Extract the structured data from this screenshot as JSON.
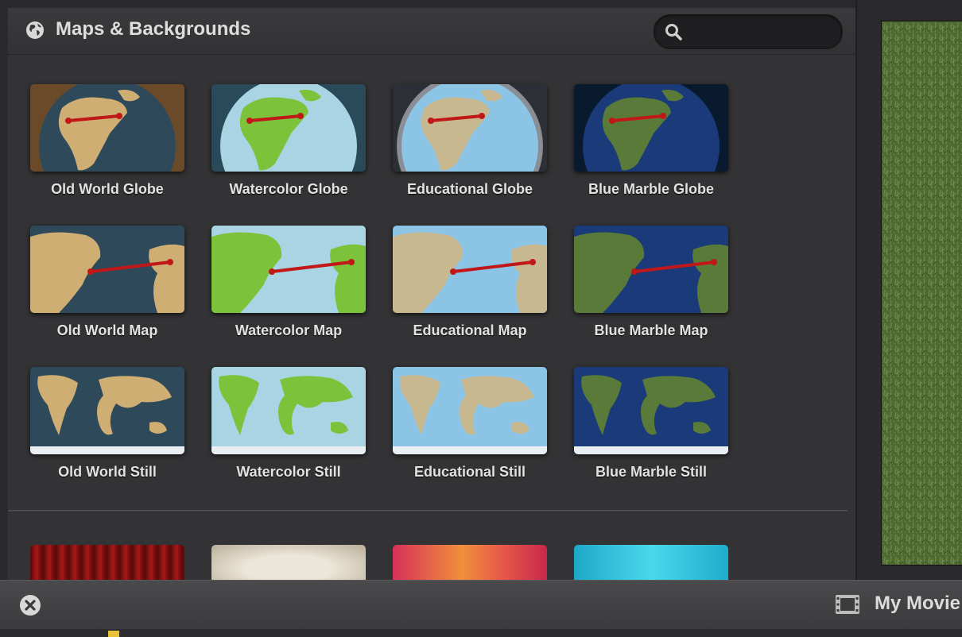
{
  "header": {
    "title": "Maps & Backgrounds",
    "icon": "globe-icon"
  },
  "search": {
    "placeholder": "",
    "value": "",
    "icon": "search-icon"
  },
  "maps": [
    {
      "label": "Old World Globe",
      "style": "oldworld",
      "kind": "globe"
    },
    {
      "label": "Watercolor Globe",
      "style": "watercolor",
      "kind": "globe"
    },
    {
      "label": "Educational Globe",
      "style": "educational",
      "kind": "globe"
    },
    {
      "label": "Blue Marble Globe",
      "style": "bluemarble",
      "kind": "globe"
    },
    {
      "label": "Old World Map",
      "style": "oldworld",
      "kind": "map"
    },
    {
      "label": "Watercolor Map",
      "style": "watercolor",
      "kind": "map"
    },
    {
      "label": "Educational Map",
      "style": "educational",
      "kind": "map"
    },
    {
      "label": "Blue Marble Map",
      "style": "bluemarble",
      "kind": "map"
    },
    {
      "label": "Old World Still",
      "style": "oldworld",
      "kind": "still"
    },
    {
      "label": "Watercolor Still",
      "style": "watercolor",
      "kind": "still"
    },
    {
      "label": "Educational Still",
      "style": "educational",
      "kind": "still"
    },
    {
      "label": "Blue Marble Still",
      "style": "bluemarble",
      "kind": "still"
    }
  ],
  "backgrounds": [
    {
      "name": "curtain",
      "color": "#8a1010"
    },
    {
      "name": "parchment",
      "color": "#d9d2c0"
    },
    {
      "name": "sunset",
      "color": "#e8503a"
    },
    {
      "name": "aqua",
      "color": "#30c4dc"
    }
  ],
  "bottom_bar": {
    "close_icon": "close-icon",
    "film_icon": "film-icon",
    "movie_label": "My Movie"
  },
  "colors": {
    "oldworld_bg": "#6b4a2a",
    "oldworld_sea": "#2e4a5a",
    "oldworld_land": "#cfae74",
    "watercolor_bg": "#2a4a5a",
    "watercolor_sea": "#a8d4e4",
    "watercolor_land": "#7cc23a",
    "educational_bg": "#2c3036",
    "educational_sea": "#8cc4e6",
    "educational_land": "#c8b890",
    "bluemarble_bg": "#0a1a2e",
    "bluemarble_sea": "#1a3a7a",
    "bluemarble_land": "#5a7a3a",
    "route": "#c01818"
  }
}
